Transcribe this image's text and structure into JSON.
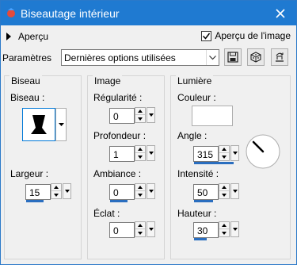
{
  "window": {
    "title": "Biseautage intérieur"
  },
  "preview": {
    "label": "Aperçu",
    "checkbox_label": "Aperçu de l'image",
    "checked": true
  },
  "params": {
    "label": "Paramètres",
    "selected": "Dernières options utilisées"
  },
  "groups": {
    "biseau": {
      "title": "Biseau",
      "shape_label": "Biseau :",
      "width_label": "Largeur :",
      "width_value": "15",
      "width_level": 0.6
    },
    "image": {
      "title": "Image",
      "regularite_label": "Régularité :",
      "regularite_value": "0",
      "profondeur_label": "Profondeur :",
      "profondeur_value": "1",
      "ambiance_label": "Ambiance :",
      "ambiance_value": "0",
      "eclat_label": "Éclat :",
      "eclat_value": "0"
    },
    "lumiere": {
      "title": "Lumière",
      "couleur_label": "Couleur :",
      "couleur": "#ffffff",
      "angle_label": "Angle :",
      "angle_value": "315",
      "intensite_label": "Intensité :",
      "intensite_value": "50",
      "hauteur_label": "Hauteur :",
      "hauteur_value": "30"
    }
  },
  "colors": {
    "titlebar": "#1f7ad1",
    "accent": "#2a6ebf"
  }
}
